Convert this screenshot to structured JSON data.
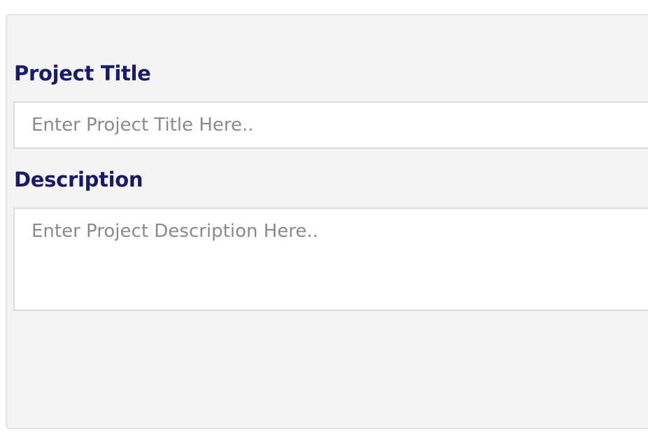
{
  "form": {
    "title_label": "Project Title",
    "title_placeholder": "Enter Project Title Here..",
    "title_value": "",
    "description_label": "Description",
    "description_placeholder": "Enter Project Description Here..",
    "description_value": ""
  },
  "colors": {
    "label": "#1a1a6b",
    "panel_background": "#f4f4f4",
    "input_background": "#ffffff",
    "input_border": "#dcdcdc",
    "placeholder": "#8a8a8a"
  }
}
